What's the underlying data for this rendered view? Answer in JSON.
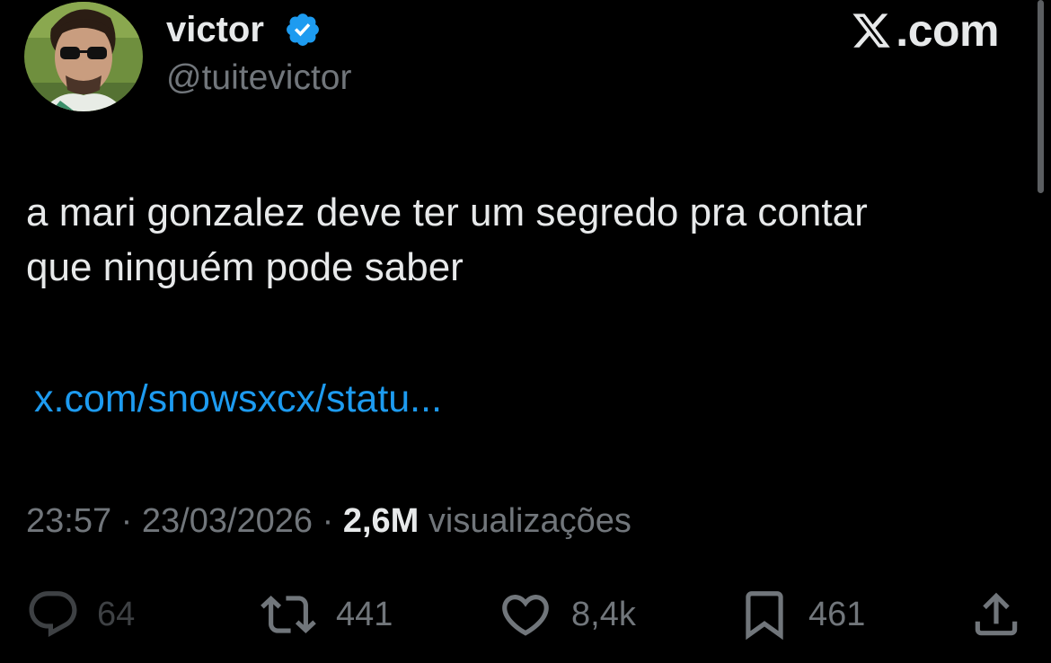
{
  "user": {
    "display_name": "victor",
    "handle": "@tuitevictor",
    "verified_icon": "verified-badge-icon",
    "avatar_icon": "profile-photo"
  },
  "brand": {
    "icon": "x-logo-icon",
    "text": ".com"
  },
  "tweet": {
    "lines": [
      "a mari gonzalez deve ter um segredo pra contar",
      "que ninguém pode saber"
    ],
    "link": "x.com/snowsxcx/statu..."
  },
  "meta": {
    "time": "23:57",
    "separator": "·",
    "date": "23/03/2026",
    "views_count": "2,6M",
    "views_label": "visualizações"
  },
  "actions": {
    "reply": {
      "icon": "reply-icon",
      "count": "64"
    },
    "retweet": {
      "icon": "retweet-icon",
      "count": "441"
    },
    "like": {
      "icon": "heart-icon",
      "count": "8,4k"
    },
    "bookmark": {
      "icon": "bookmark-icon",
      "count": "461"
    },
    "share": {
      "icon": "share-icon"
    }
  },
  "colors": {
    "background": "#000000",
    "text": "#e7e9ea",
    "secondary": "#71767b",
    "link": "#1d9bf0",
    "verified": "#1d9bf0"
  }
}
